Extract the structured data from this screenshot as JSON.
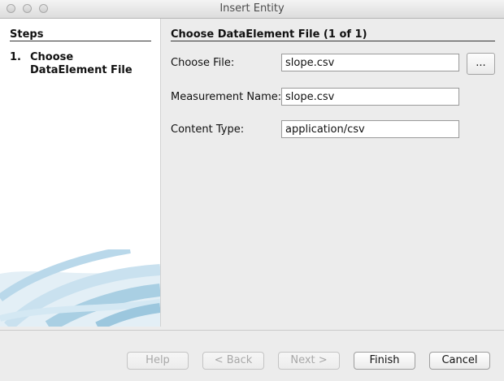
{
  "window": {
    "title": "Insert Entity"
  },
  "steps": {
    "header": "Steps",
    "items": [
      {
        "number": "1.",
        "label": "Choose DataElement File"
      }
    ]
  },
  "panel": {
    "title": "Choose DataElement File (1 of 1)",
    "fields": {
      "file": {
        "label": "Choose File:",
        "value": "slope.csv"
      },
      "measurement": {
        "label": "Measurement Name:",
        "value": "slope.csv"
      },
      "content_type": {
        "label": "Content Type:",
        "value": "application/csv"
      }
    },
    "browse_label": "..."
  },
  "buttons": {
    "help": "Help",
    "back": "< Back",
    "next": "Next >",
    "finish": "Finish",
    "cancel": "Cancel"
  },
  "colors": {
    "sidebar_bg": "#ffffff",
    "swoosh": "#9cc7de",
    "window_bg": "#ececec"
  }
}
